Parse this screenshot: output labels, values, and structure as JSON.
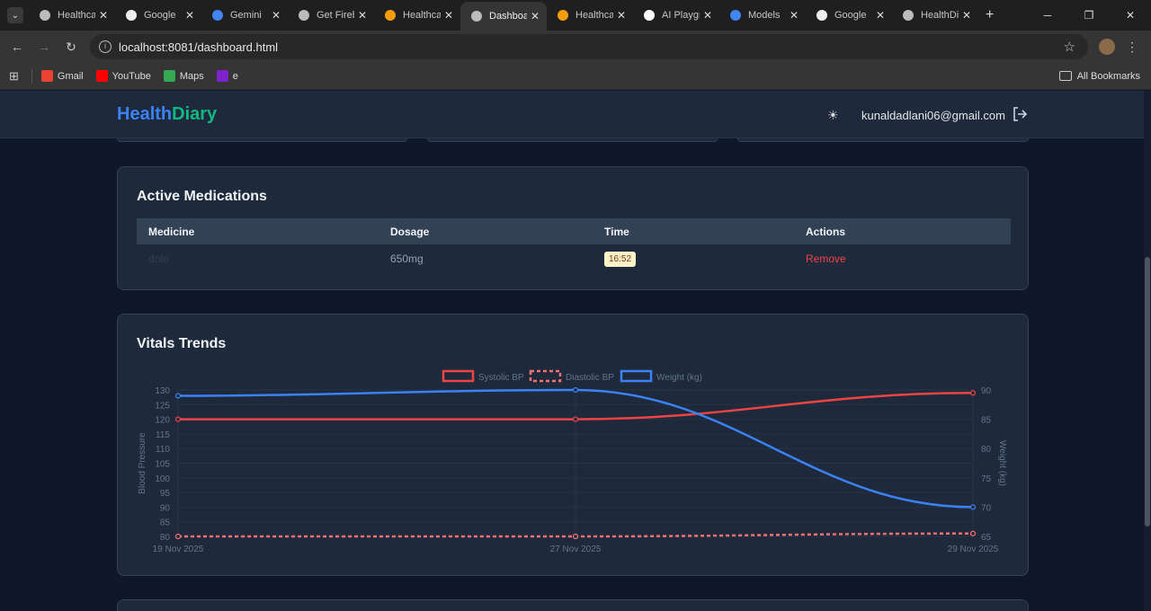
{
  "browser": {
    "tabs": [
      {
        "label": "Healthca",
        "icon": "globe-icon",
        "active": false
      },
      {
        "label": "Google",
        "icon": "bookmark-icon",
        "active": false
      },
      {
        "label": "Gemini",
        "icon": "google-icon",
        "active": false
      },
      {
        "label": "Get Fireb",
        "icon": "globe-icon",
        "active": false
      },
      {
        "label": "Healthca",
        "icon": "firebase-icon",
        "active": false
      },
      {
        "label": "Dashboa",
        "icon": "globe-icon",
        "active": true
      },
      {
        "label": "Healthca",
        "icon": "firebase-icon",
        "active": false
      },
      {
        "label": "AI Playgr",
        "icon": "triangle-icon",
        "active": false
      },
      {
        "label": "Models",
        "icon": "google-icon",
        "active": false
      },
      {
        "label": "Google",
        "icon": "bookmark-icon",
        "active": false
      },
      {
        "label": "HealthDi",
        "icon": "globe-icon",
        "active": false
      }
    ],
    "url": "localhost:8081/dashboard.html",
    "bookmarks": [
      {
        "label": "Gmail",
        "icon": "gmail-icon",
        "color": "#ea4335"
      },
      {
        "label": "YouTube",
        "icon": "youtube-icon",
        "color": "#ff0000"
      },
      {
        "label": "Maps",
        "icon": "maps-icon",
        "color": "#34a853"
      },
      {
        "label": "e",
        "icon": "app-icon",
        "color": "#7e22ce"
      }
    ],
    "all_bookmarks_label": "All Bookmarks"
  },
  "header": {
    "brand_part1": "Health",
    "brand_part2": "Diary",
    "user_email": "kunaldadlani06@gmail.com"
  },
  "medications": {
    "title": "Active Medications",
    "columns": [
      "Medicine",
      "Dosage",
      "Time",
      "Actions"
    ],
    "rows": [
      {
        "medicine": "dolo",
        "dosage": "650mg",
        "time": "16:52",
        "action": "Remove"
      }
    ]
  },
  "vitals": {
    "title": "Vitals Trends"
  },
  "chart_data": {
    "type": "line",
    "x": [
      "19 Nov 2025",
      "27 Nov 2025",
      "29 Nov 2025"
    ],
    "series": [
      {
        "name": "Systolic BP",
        "values": [
          120,
          120,
          129
        ],
        "axis": "left",
        "color": "#ef4444",
        "dashed": false
      },
      {
        "name": "Diastolic BP",
        "values": [
          80,
          80,
          81
        ],
        "axis": "left",
        "color": "#f87171",
        "dashed": true
      },
      {
        "name": "Weight (kg)",
        "values": [
          89,
          90,
          70
        ],
        "axis": "right",
        "color": "#3b82f6",
        "dashed": false
      }
    ],
    "ylabel": "Blood Pressure",
    "y2label": "Weight (kg)",
    "ylim": [
      80,
      130
    ],
    "y2lim": [
      65,
      90
    ],
    "yticks": [
      130,
      125,
      120,
      115,
      110,
      105,
      100,
      95,
      90,
      85,
      80
    ],
    "y2ticks": [
      90,
      85,
      80,
      75,
      70,
      65
    ],
    "legend": "top-center",
    "grid": true
  }
}
